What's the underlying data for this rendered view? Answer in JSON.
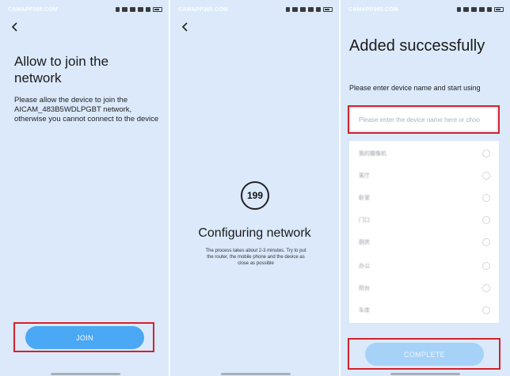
{
  "watermark": "CAMAPP365.COM",
  "screens": {
    "join": {
      "title": "Allow to join the network",
      "description": "Please allow the device to join the AICAM_483B5WDLPGBT network, otherwise you cannot connect to the device",
      "button_label": "JOIN"
    },
    "configuring": {
      "countdown": "199",
      "title": "Configuring network",
      "description": "The process takes about 2-3 minutes. Try to put the router, the mobile phone and the device as close as possible"
    },
    "added": {
      "title": "Added successfully",
      "description": "Please enter device name and start using",
      "name_placeholder": "Please enter the device name here or choo",
      "name_value": "",
      "options": [
        {
          "label": "我的摄像机",
          "selected": false
        },
        {
          "label": "客厅",
          "selected": false
        },
        {
          "label": "卧室",
          "selected": false
        },
        {
          "label": "门口",
          "selected": false
        },
        {
          "label": "厨房",
          "selected": false
        },
        {
          "label": "办公",
          "selected": false
        },
        {
          "label": "阳台",
          "selected": false
        },
        {
          "label": "车库",
          "selected": false
        }
      ],
      "button_label": "COMPLETE"
    }
  },
  "colors": {
    "background": "#dbe9fb",
    "primary_button": "#4aa8f5",
    "disabled_button": "#a6d2f8",
    "highlight_border": "#d3222a"
  }
}
